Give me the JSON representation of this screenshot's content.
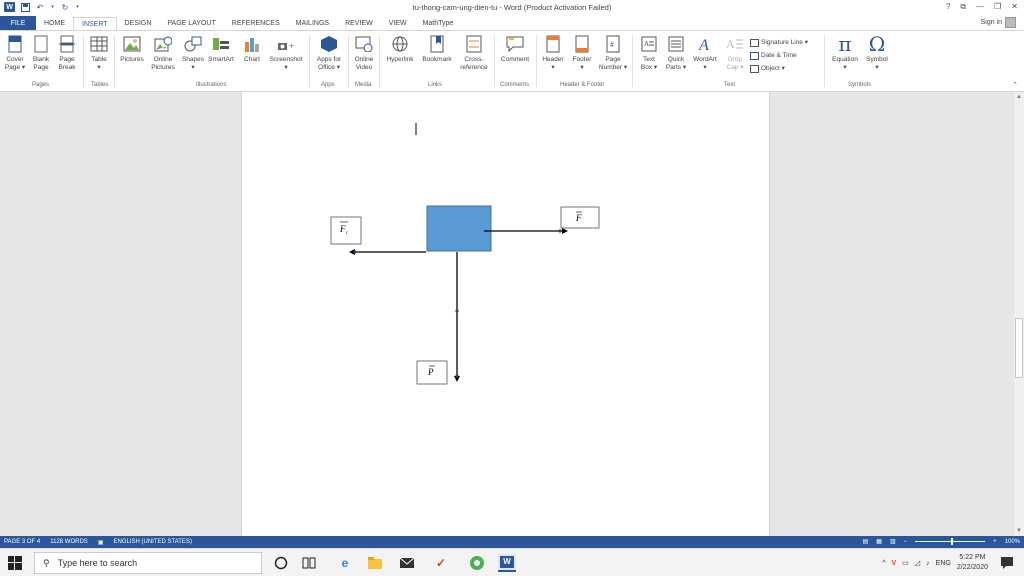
{
  "window": {
    "title": "tu-thong-cam-ung-dien-tu - Word (Product Activation Failed)",
    "controls": [
      "?",
      "⧉",
      "—",
      "❐",
      "✕"
    ]
  },
  "tabs": [
    {
      "label": "FILE"
    },
    {
      "label": "HOME"
    },
    {
      "label": "INSERT"
    },
    {
      "label": "DESIGN"
    },
    {
      "label": "PAGE LAYOUT"
    },
    {
      "label": "REFERENCES"
    },
    {
      "label": "MAILINGS"
    },
    {
      "label": "REVIEW"
    },
    {
      "label": "VIEW"
    },
    {
      "label": "MathType"
    }
  ],
  "active_tab": "INSERT",
  "signin": "Sign in",
  "ribbon": {
    "pages": {
      "cover": "Cover\nPage ▾",
      "blank": "Blank\nPage",
      "break": "Page\nBreak",
      "group": "Pages"
    },
    "tables": {
      "table": "Table\n▾",
      "group": "Tables"
    },
    "illustrations": {
      "pictures": "Pictures",
      "online_pictures": "Online\nPictures",
      "shapes": "Shapes\n▾",
      "smartart": "SmartArt",
      "chart": "Chart",
      "screenshot": "Screenshot\n▾",
      "group": "Illustrations"
    },
    "apps": {
      "apps_office": "Apps for\nOffice ▾",
      "group": "Apps"
    },
    "media": {
      "online_video": "Online\nVideo",
      "group": "Media"
    },
    "links": {
      "hyperlink": "Hyperlink",
      "bookmark": "Bookmark",
      "cross_reference": "Cross-\nreference",
      "group": "Links"
    },
    "comments": {
      "comment": "Comment",
      "group": "Comments"
    },
    "header_footer": {
      "header": "Header\n▾",
      "footer": "Footer\n▾",
      "page_number": "Page\nNumber ▾",
      "group": "Header & Footer"
    },
    "text": {
      "text_box": "Text\nBox ▾",
      "quick_parts": "Quick\nParts ▾",
      "wordart": "WordArt\n▾",
      "drop_cap": "Drop\nCap ▾",
      "signature_line": "Signature Line ▾",
      "date_time": "Date & Time",
      "object": "Object ▾",
      "group": "Text"
    },
    "symbols": {
      "equation": "Equation\n▾",
      "symbol": "Symbol\n▾",
      "group": "Symbols"
    }
  },
  "document": {
    "labels": {
      "fc": "F",
      "fc_sub": "c",
      "f_right": "F",
      "p_down": "P"
    }
  },
  "status": {
    "page": "PAGE 3 OF 4",
    "words": "1128 WORDS",
    "language": "ENGLISH (UNITED STATES)",
    "zoom": "100%",
    "zoom_minus": "−",
    "zoom_plus": "+"
  },
  "taskbar": {
    "search_placeholder": "Type here to search",
    "lang": "ENG",
    "time": "5:22 PM",
    "date": "2/22/2020"
  },
  "colors": {
    "accent": "#2b579a",
    "box_fill": "#5b9bd5"
  }
}
